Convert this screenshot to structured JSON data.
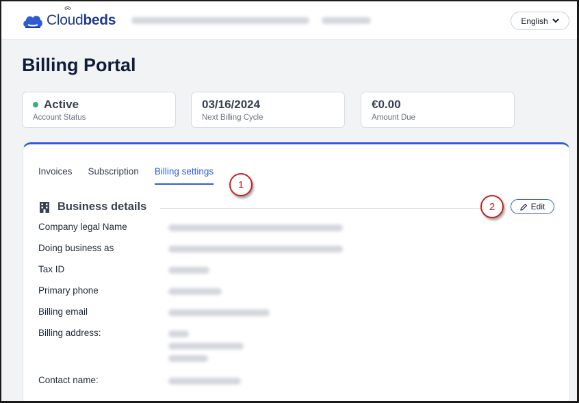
{
  "header": {
    "logo_text_regular": "Cloud",
    "logo_text_bold": "beds",
    "language": "English"
  },
  "page": {
    "title": "Billing Portal"
  },
  "cards": [
    {
      "value": "Active",
      "label": "Account Status",
      "status_color": "#35b07d"
    },
    {
      "value": "03/16/2024",
      "label": "Next Billing Cycle"
    },
    {
      "value": "€0.00",
      "label": "Amount Due"
    }
  ],
  "tabs": [
    {
      "label": "Invoices"
    },
    {
      "label": "Subscription"
    },
    {
      "label": "Billing settings",
      "active": true
    }
  ],
  "callouts": [
    "1",
    "2"
  ],
  "business_details": {
    "heading": "Business details",
    "edit_label": "Edit",
    "fields": [
      {
        "label": "Company legal Name"
      },
      {
        "label": "Doing business as"
      },
      {
        "label": "Tax ID"
      },
      {
        "label": "Primary phone"
      },
      {
        "label": "Billing email"
      },
      {
        "label": "Billing address:"
      },
      {
        "label": "Contact name:"
      }
    ]
  },
  "colors": {
    "accent": "#2f5bd6",
    "brand": "#1e3a8a",
    "callout": "#c81e1e"
  }
}
